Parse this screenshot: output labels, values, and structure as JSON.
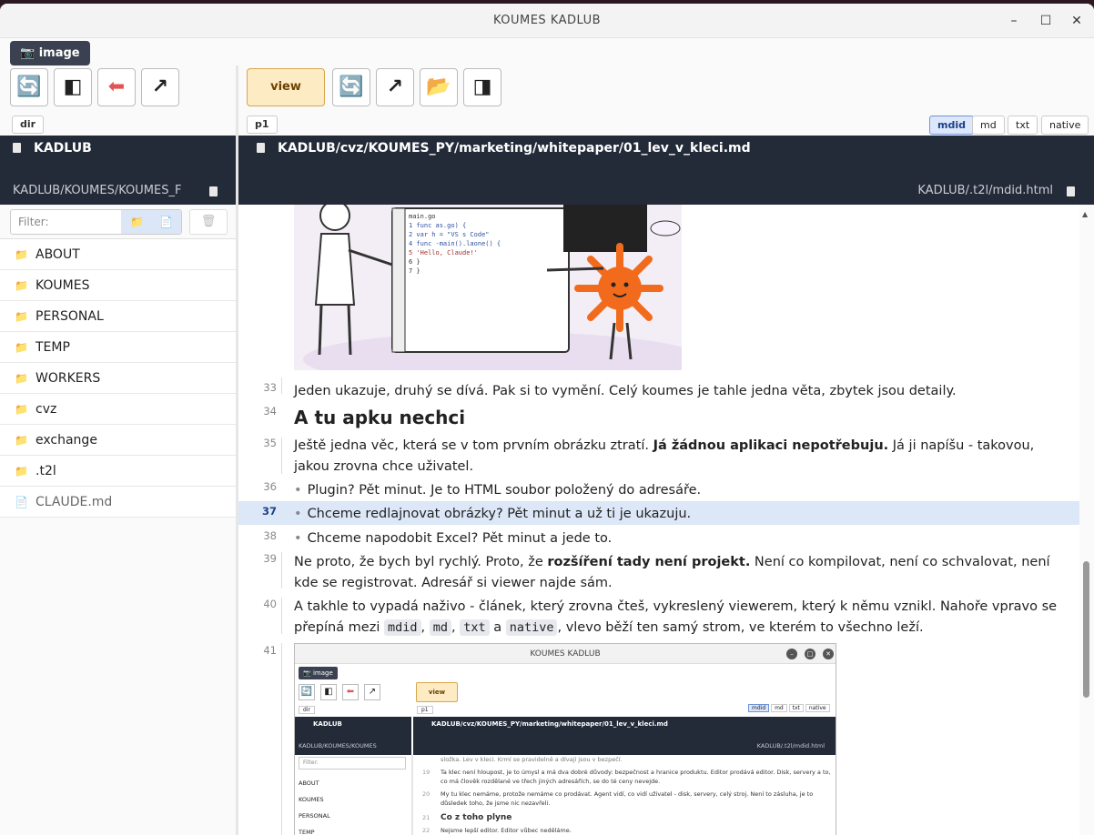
{
  "window": {
    "title": "KOUMES  KADLUB",
    "minimize": "–",
    "maximize": "☐",
    "close": "✕"
  },
  "menu": {
    "image_label": "📷 image"
  },
  "left_toolbar": [
    {
      "name": "refresh",
      "glyph": "🔄"
    },
    {
      "name": "contrast",
      "glyph": "◧"
    },
    {
      "name": "back",
      "glyph": "⬅"
    },
    {
      "name": "open-external",
      "glyph": "↗"
    }
  ],
  "right_toolbar": {
    "view_label": "view",
    "buttons": [
      {
        "name": "refresh",
        "glyph": "🔄"
      },
      {
        "name": "open-external",
        "glyph": "↗"
      },
      {
        "name": "folder",
        "glyph": "📂"
      },
      {
        "name": "contrast",
        "glyph": "◨"
      }
    ]
  },
  "left_chip": "dir",
  "right_chip": "p1",
  "modes": [
    "mdid",
    "md",
    "txt",
    "native"
  ],
  "active_mode": "mdid",
  "left_header": {
    "title": "KADLUB",
    "path": "KADLUB/KOUMES/KOUMES_F"
  },
  "right_header": {
    "title": "KADLUB/cvz/KOUMES_PY/marketing/whitepaper/01_lev_v_kleci.md",
    "path": "KADLUB/.t2l/mdid.html"
  },
  "filter": {
    "placeholder": "Filter:"
  },
  "tree": [
    {
      "label": "ABOUT",
      "type": "folder"
    },
    {
      "label": "KOUMES",
      "type": "folder"
    },
    {
      "label": "PERSONAL",
      "type": "folder"
    },
    {
      "label": "TEMP",
      "type": "folder"
    },
    {
      "label": "WORKERS",
      "type": "folder"
    },
    {
      "label": "cvz",
      "type": "folder"
    },
    {
      "label": "exchange",
      "type": "folder"
    },
    {
      "label": ".t2l",
      "type": "folder"
    },
    {
      "label": "CLAUDE.md",
      "type": "file"
    }
  ],
  "doc": {
    "image1_code": [
      "main.go",
      "1  func as.go) {",
      "2  var h = \"VS s Code\"",
      "",
      "4  func -main().laone() {",
      "5    'Hello, Claude!'",
      "6  }",
      "7  }"
    ],
    "lines": {
      "l33": {
        "num": "33",
        "text": "Jeden ukazuje, druhý se dívá. Pak si to vymění. Celý koumes je tahle jedna věta, zbytek jsou detaily."
      },
      "l34": {
        "num": "34",
        "text": "A tu apku nechci"
      },
      "l35": {
        "num": "35",
        "pre": "Ještě jedna věc, která se v tom prvním obrázku ztratí. ",
        "bold": "Já žádnou aplikaci nepotřebuju.",
        "post": " Já ji napíšu - takovou, jakou zrovna chce uživatel."
      },
      "l36": {
        "num": "36",
        "text": "Plugin? Pět minut. Je to HTML soubor položený do adresáře."
      },
      "l37": {
        "num": "37",
        "text": "Chceme redlajnovat obrázky? Pět minut a už ti je ukazuju."
      },
      "l38": {
        "num": "38",
        "text": "Chceme napodobit Excel? Pět minut a jede to."
      },
      "l39": {
        "num": "39",
        "pre": "Ne proto, že bych byl rychlý. Proto, že ",
        "bold": "rozšíření tady není projekt.",
        "post": " Není co kompilovat, není co schvalovat, není kde se registrovat. Adresář si viewer najde sám."
      },
      "l40": {
        "num": "40",
        "pre": "A takhle to vypadá naživo - článek, který zrovna čteš, vykreslený viewerem, který k němu vznikl. Nahoře vpravo se přepíná mezi ",
        "c1": "mdid",
        "c2": "md",
        "c3": "txt",
        "and": " a ",
        "c4": "native",
        "post": ", vlevo běží ten samý strom, ve kterém to všechno leží."
      },
      "l41": {
        "num": "41"
      }
    },
    "mini": {
      "title": "KOUMES  KADLUB",
      "image_label": "📷 image",
      "view_label": "view",
      "dir": "dir",
      "p1": "p1",
      "modes": [
        "mdid",
        "md",
        "txt",
        "native"
      ],
      "left_title": "KADLUB",
      "left_path": "KADLUB/KOUMES/KOUMES",
      "right_title": "KADLUB/cvz/KOUMES_PY/marketing/whitepaper/01_lev_v_kleci.md",
      "right_path": "KADLUB/.t2l/mdid.html",
      "filter": "Filter:",
      "tree": [
        "ABOUT",
        "KOUMES",
        "PERSONAL",
        "TEMP"
      ],
      "text0": "složka. Lev v kleci. Krmí se pravidelně a dívají jsou v bezpečí.",
      "n19": "19",
      "t19": "Ta klec není hloupost, je to úmysl a má dva dobré důvody: bezpečnost a hranice produktu. Editor prodává editor. Disk, servery a to, co má člověk rozdělané ve třech jiných adresářích, se do té ceny nevejde.",
      "n20": "20",
      "t20": "My tu klec nemáme, protože nemáme co prodávat. Agent vidí, co vidí uživatel - disk, servery, celý stroj. Není to zásluha, je to důsledek toho, že jsme nic nezavřeli.",
      "n21": "21",
      "t21": "Co z toho plyne",
      "n22": "22",
      "t22": "Nejsme lepší editor. Editor vůbec neděláme."
    }
  }
}
